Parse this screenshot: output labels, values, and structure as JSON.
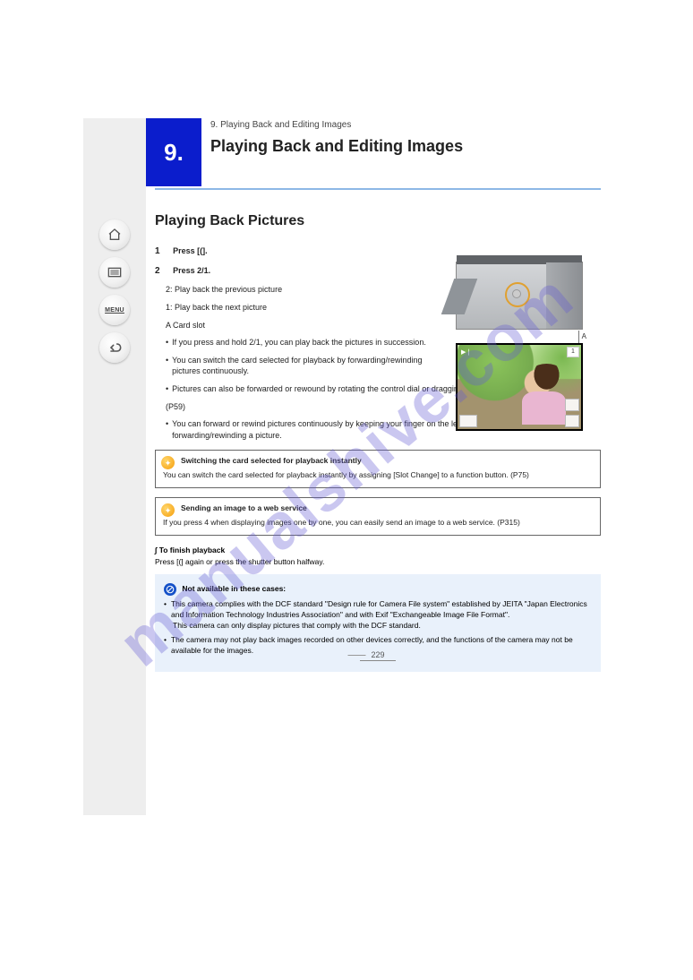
{
  "watermark": "manualshive.com",
  "sidebar": {
    "icons": {
      "home": "home-icon",
      "list": "list-icon",
      "menu_label": "MENU",
      "back": "back-icon"
    }
  },
  "chapter": {
    "number": "9.",
    "kicker": "9. Playing Back and Editing Images",
    "title": "Playing Back and Editing Images"
  },
  "section": {
    "heading": "Playing Back Pictures",
    "step1_label": "1",
    "step1_text": "Press [(].",
    "step2_label": "2",
    "step2_text": "Press 2/1.",
    "step2_left": "2: Play back the previous picture",
    "step2_right": "1: Play back the next picture",
    "callout_a": "A",
    "callout_a_text": "Card slot",
    "bullets": [
      "If you press and hold 2/1, you can play back the pictures in succession.",
      "You can switch the card selected for playback by forwarding/rewinding pictures continuously.",
      "Pictures can also be forwarded or rewound by rotating the control dial or dragging the screen horizontally.",
      "(P59)",
      "You can forward or rewind pictures continuously by keeping your finger on the left or right sides of the screen after forwarding/rewinding a picture."
    ],
    "photo_counter": "1"
  },
  "tip1": {
    "title": "Switching the card selected for playback instantly",
    "body": "You can switch the card selected for playback instantly by assigning [Slot Change] to a function button. (P75)"
  },
  "tip2": {
    "title": "Sending an image to a web service",
    "body": "If you press 4 when displaying images one by one, you can easily send an image to a web service. (P315)"
  },
  "finish": {
    "title": "∫ To finish playback",
    "body": "Press [(] again or press the shutter button halfway."
  },
  "unavailable": {
    "title": "Not available in these cases:",
    "items": [
      "This camera complies with the DCF standard \"Design rule for Camera File system\" established by JEITA \"Japan Electronics and Information Technology Industries Association\" and with Exif \"Exchangeable Image File Format\".",
      "This camera can only display pictures that comply with the DCF standard.",
      "The camera may not play back images recorded on other devices correctly, and the functions of the camera may not be available for the images."
    ]
  },
  "page_number": "229"
}
